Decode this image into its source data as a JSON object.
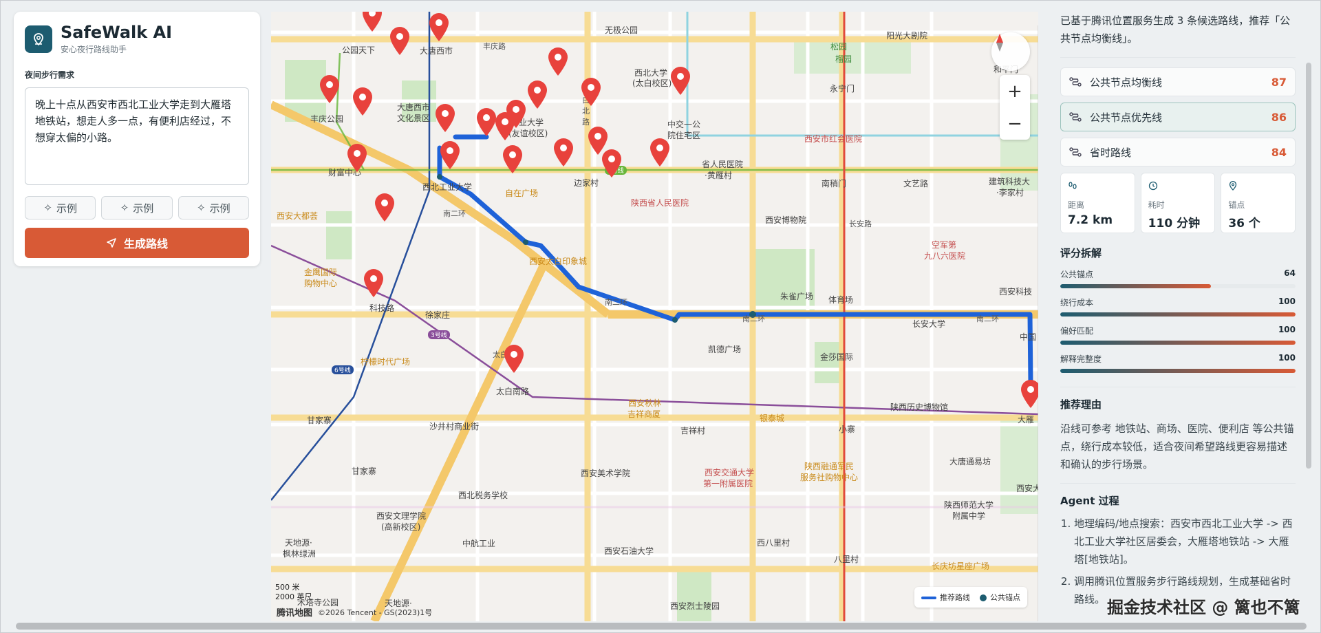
{
  "app": {
    "title": "SafeWalk AI",
    "subtitle": "安心夜行路线助手"
  },
  "form": {
    "label": "夜间步行需求",
    "request": "晚上十点从西安市西北工业大学走到大雁塔地铁站，想走人多一点，有便利店经过，不想穿太偏的小路。",
    "examples": [
      "示例",
      "示例",
      "示例"
    ],
    "generate_label": "生成路线"
  },
  "map": {
    "labels": [
      {
        "t": "无极公园",
        "c": ""
      },
      {
        "t": "丰庆路",
        "c": "road"
      },
      {
        "t": "大唐西市",
        "c": ""
      },
      {
        "t": "公园天下",
        "c": ""
      },
      {
        "t": "丰庆公园",
        "c": ""
      },
      {
        "t": "大唐西市",
        "c": ""
      },
      {
        "t": "文化景区",
        "c": ""
      },
      {
        "t": "西北大学",
        "c": ""
      },
      {
        "t": "(太白校区)",
        "c": ""
      },
      {
        "t": "业大学",
        "c": ""
      },
      {
        "t": "(友谊校区)",
        "c": ""
      },
      {
        "t": "太",
        "c": "road"
      },
      {
        "t": "白",
        "c": "road"
      },
      {
        "t": "北",
        "c": "road"
      },
      {
        "t": "路",
        "c": "road"
      },
      {
        "t": "中交一公",
        "c": ""
      },
      {
        "t": "院住宅区",
        "c": ""
      },
      {
        "t": "阳光大剧院",
        "c": ""
      },
      {
        "t": "松园",
        "c": "green"
      },
      {
        "t": "榴园",
        "c": "green"
      },
      {
        "t": "永宁门",
        "c": ""
      },
      {
        "t": "和平门",
        "c": ""
      },
      {
        "t": "西安市红会医院",
        "c": "red"
      },
      {
        "t": "省人民医院",
        "c": ""
      },
      {
        "t": "·黄雁村",
        "c": ""
      },
      {
        "t": "南稍门",
        "c": ""
      },
      {
        "t": "文艺路",
        "c": ""
      },
      {
        "t": "建筑科技大",
        "c": ""
      },
      {
        "t": "·李家村",
        "c": ""
      },
      {
        "t": "财富中心",
        "c": ""
      },
      {
        "t": "西北工业大学",
        "c": ""
      },
      {
        "t": "自在广场",
        "c": "orange"
      },
      {
        "t": "边家村",
        "c": ""
      },
      {
        "t": "陕西省人民医院",
        "c": "red"
      },
      {
        "t": "西安大都荟",
        "c": "orange"
      },
      {
        "t": "南二环",
        "c": "road"
      },
      {
        "t": "西安太白印象城",
        "c": "orange"
      },
      {
        "t": "西安博物院",
        "c": ""
      },
      {
        "t": "空军第",
        "c": "red"
      },
      {
        "t": "九八六医院",
        "c": "red"
      },
      {
        "t": "金鹰国际",
        "c": "orange"
      },
      {
        "t": "购物中心",
        "c": "orange"
      },
      {
        "t": "科技路",
        "c": ""
      },
      {
        "t": "朱雀广场",
        "c": ""
      },
      {
        "t": "体育场",
        "c": ""
      },
      {
        "t": "徐家庄",
        "c": ""
      },
      {
        "t": "南二环",
        "c": "road"
      },
      {
        "t": "南二环",
        "c": "road"
      },
      {
        "t": "长安大学",
        "c": ""
      },
      {
        "t": "南二环",
        "c": "road"
      },
      {
        "t": "西安科技",
        "c": ""
      },
      {
        "t": "柠檬时代广场",
        "c": "orange"
      },
      {
        "t": "凯德广场",
        "c": ""
      },
      {
        "t": "金莎国际",
        "c": ""
      },
      {
        "t": "太白南路",
        "c": ""
      },
      {
        "t": "西安秋林",
        "c": "orange"
      },
      {
        "t": "吉祥商厦",
        "c": "orange"
      },
      {
        "t": "银泰城",
        "c": "orange"
      },
      {
        "t": "陕西历史博物馆",
        "c": ""
      },
      {
        "t": "甘家寨",
        "c": ""
      },
      {
        "t": "吉祥村",
        "c": ""
      },
      {
        "t": "小寨",
        "c": ""
      },
      {
        "t": "沙井村商业街",
        "c": ""
      },
      {
        "t": "甘家寨",
        "c": ""
      },
      {
        "t": "西安美术学院",
        "c": ""
      },
      {
        "t": "西安交通大学",
        "c": "red"
      },
      {
        "t": "第一附属医院",
        "c": "red"
      },
      {
        "t": "陕西融通军民",
        "c": "orange"
      },
      {
        "t": "服务社购物中心",
        "c": "orange"
      },
      {
        "t": "大唐通易坊",
        "c": ""
      },
      {
        "t": "西北税务学校",
        "c": ""
      },
      {
        "t": "西安文理学院",
        "c": ""
      },
      {
        "t": "(高新校区)",
        "c": ""
      },
      {
        "t": "陕西师范大学",
        "c": ""
      },
      {
        "t": "附属中学",
        "c": ""
      },
      {
        "t": "中航工业",
        "c": ""
      },
      {
        "t": "天地源·",
        "c": ""
      },
      {
        "t": "枫林绿洲",
        "c": ""
      },
      {
        "t": "西安石油大学",
        "c": ""
      },
      {
        "t": "西八里村",
        "c": ""
      },
      {
        "t": "八里村",
        "c": ""
      },
      {
        "t": "长庆坊星座广场",
        "c": "orange"
      },
      {
        "t": "木塔寺公园",
        "c": ""
      },
      {
        "t": "天地源·",
        "c": ""
      },
      {
        "t": "西安烈士陵园",
        "c": ""
      },
      {
        "t": "太白南路",
        "c": "road"
      },
      {
        "t": "长安路",
        "c": "road"
      },
      {
        "t": "中国",
        "c": ""
      },
      {
        "t": "大雁",
        "c": ""
      },
      {
        "t": "西安大",
        "c": ""
      }
    ],
    "badges": [
      "5号线",
      "3号线",
      "6号线"
    ],
    "scale": [
      "500 米",
      "2000 英尺"
    ],
    "copyright": "腾讯地图",
    "copyright2": "©2026 Tencent - GS(2023)1号",
    "legend": {
      "route": "推荐路线",
      "anchor": "公共锚点"
    }
  },
  "panel": {
    "intro": "已基于腾讯位置服务生成 3 条候选路线，推荐「公共节点均衡线」。",
    "routes": [
      {
        "name": "公共节点均衡线",
        "score": "87",
        "active": false
      },
      {
        "name": "公共节点优先线",
        "score": "86",
        "active": true
      },
      {
        "name": "省时路线",
        "score": "84",
        "active": false
      }
    ],
    "stats": [
      {
        "label": "距离",
        "value": "7.2 km",
        "icon": "footprints-icon"
      },
      {
        "label": "耗时",
        "value": "110 分钟",
        "icon": "clock-icon"
      },
      {
        "label": "锚点",
        "value": "36 个",
        "icon": "map-pin-icon"
      }
    ],
    "score_title": "评分拆解",
    "scores": [
      {
        "label": "公共锚点",
        "value": 64
      },
      {
        "label": "绕行成本",
        "value": 100
      },
      {
        "label": "偏好匹配",
        "value": 100
      },
      {
        "label": "解释完整度",
        "value": 100
      }
    ],
    "reason_title": "推荐理由",
    "reason": "沿线可参考 地铁站、商场、医院、便利店 等公共锚点，绕行成本较低，适合夜间希望路线更容易描述和确认的步行场景。",
    "agent_title": "Agent 过程",
    "agent_steps": [
      "地理编码/地点搜索：西安市西北工业大学 -> 西北工业大学社区居委会，大雁塔地铁站 -> 大雁塔[地铁站]。",
      "调用腾讯位置服务步行路线规划，生成基础省时路线。"
    ]
  },
  "watermark": "掘金技术社区 @ 篱也不篱",
  "colors": {
    "accent": "#d85a36",
    "brand": "#1d5c70",
    "route": "#1e62d8"
  }
}
